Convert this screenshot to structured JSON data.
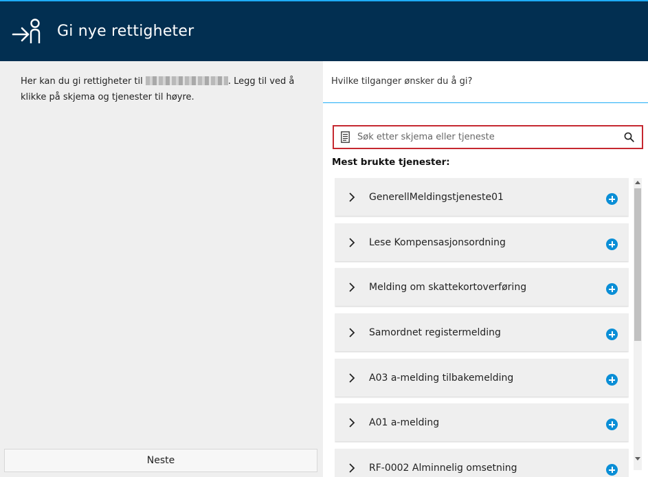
{
  "header": {
    "title": "Gi nye rettigheter",
    "icon": "person-arrow-icon",
    "background": "#022f51",
    "accent": "#1eadf7"
  },
  "left_panel": {
    "intro_before": "Her kan du gi rettigheter til ",
    "intro_after": ". Legg til ved å klikke på skjema og tjenester til høyre.",
    "next_button": "Neste"
  },
  "right_panel": {
    "question": "Hvilke tilganger ønsker du å gi?",
    "search": {
      "placeholder": "Søk etter skjema eller tjeneste",
      "value": "",
      "left_icon": "document-icon",
      "right_icon": "search-icon"
    },
    "most_used_heading": "Mest brukte tjenester:",
    "services": [
      {
        "label": "GenerellMeldingstjeneste01"
      },
      {
        "label": "Lese Kompensasjonsordning"
      },
      {
        "label": "Melding om skattekortoverføring"
      },
      {
        "label": "Samordnet registermelding"
      },
      {
        "label": "A03 a-melding tilbakemelding"
      },
      {
        "label": "A01 a-melding"
      },
      {
        "label": "RF-0002 Alminnelig omsetning"
      }
    ],
    "add_color": "#0a8ed6"
  }
}
